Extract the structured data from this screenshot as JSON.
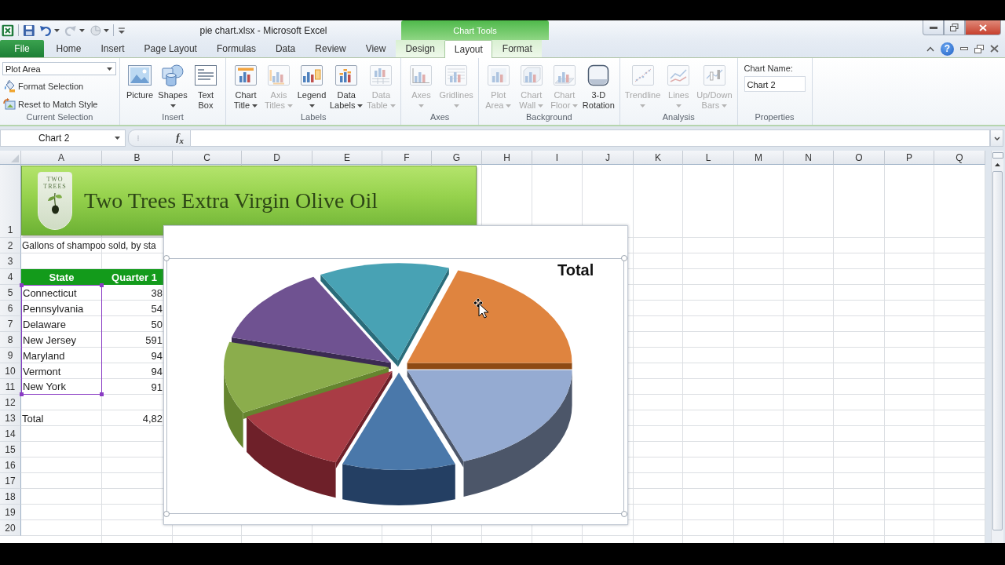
{
  "window": {
    "title": "pie chart.xlsx - Microsoft Excel",
    "contextual_group": "Chart Tools"
  },
  "ribbon_tabs": [
    {
      "label": "File",
      "kind": "file",
      "selected": false
    },
    {
      "label": "Home",
      "kind": "standard",
      "selected": false
    },
    {
      "label": "Insert",
      "kind": "standard",
      "selected": false
    },
    {
      "label": "Page Layout",
      "kind": "standard",
      "selected": false
    },
    {
      "label": "Formulas",
      "kind": "standard",
      "selected": false
    },
    {
      "label": "Data",
      "kind": "standard",
      "selected": false
    },
    {
      "label": "Review",
      "kind": "standard",
      "selected": false
    },
    {
      "label": "View",
      "kind": "standard",
      "selected": false
    },
    {
      "label": "Design",
      "kind": "contextual",
      "selected": false
    },
    {
      "label": "Layout",
      "kind": "contextual",
      "selected": true
    },
    {
      "label": "Format",
      "kind": "contextual",
      "selected": false
    }
  ],
  "help_button": "?",
  "ribbon_groups": [
    {
      "label": "Current Selection",
      "kind": "selection",
      "element_picker": "Plot Area",
      "commands": [
        {
          "label": "Format Selection",
          "disabled": false
        },
        {
          "label": "Reset to Match Style",
          "disabled": false
        }
      ]
    },
    {
      "label": "Insert",
      "kind": "large_buttons",
      "buttons": [
        {
          "label": "Picture",
          "dropdown": false,
          "disabled": false
        },
        {
          "label": "Shapes",
          "dropdown": true,
          "disabled": false
        },
        {
          "label": "Text Box",
          "dropdown": false,
          "disabled": false
        }
      ]
    },
    {
      "label": "Labels",
      "kind": "large_buttons",
      "buttons": [
        {
          "label": "Chart Title",
          "dropdown": true,
          "disabled": false
        },
        {
          "label": "Axis Titles",
          "dropdown": true,
          "disabled": true
        },
        {
          "label": "Legend",
          "dropdown": true,
          "disabled": false
        },
        {
          "label": "Data Labels",
          "dropdown": true,
          "disabled": false
        },
        {
          "label": "Data Table",
          "dropdown": true,
          "disabled": true
        }
      ]
    },
    {
      "label": "Axes",
      "kind": "large_buttons",
      "buttons": [
        {
          "label": "Axes",
          "dropdown": true,
          "disabled": true
        },
        {
          "label": "Gridlines",
          "dropdown": true,
          "disabled": true
        }
      ]
    },
    {
      "label": "Background",
      "kind": "large_buttons",
      "buttons": [
        {
          "label": "Plot Area",
          "dropdown": true,
          "disabled": true
        },
        {
          "label": "Chart Wall",
          "dropdown": true,
          "disabled": true
        },
        {
          "label": "Chart Floor",
          "dropdown": true,
          "disabled": true
        },
        {
          "label": "3-D Rotation",
          "dropdown": false,
          "disabled": false
        }
      ]
    },
    {
      "label": "Analysis",
      "kind": "large_buttons",
      "buttons": [
        {
          "label": "Trendline",
          "dropdown": true,
          "disabled": true
        },
        {
          "label": "Lines",
          "dropdown": true,
          "disabled": true
        },
        {
          "label": "Up/Down Bars",
          "dropdown": true,
          "disabled": true
        }
      ]
    },
    {
      "label": "Properties",
      "kind": "properties",
      "field_label": "Chart Name:",
      "field_value": "Chart 2"
    }
  ],
  "formula_bar": {
    "name_box": "Chart 2",
    "function_button": "f$_{x}$"
  },
  "sheet": {
    "column_headers": [
      "A",
      "B",
      "C",
      "D",
      "E",
      "F",
      "G",
      "H",
      "I",
      "J",
      "K",
      "L",
      "M",
      "N",
      "O",
      "P",
      "Q"
    ],
    "row_headers": [
      "1",
      "2",
      "3",
      "4",
      "5",
      "6",
      "7",
      "8",
      "9",
      "10",
      "11",
      "12",
      "13",
      "14",
      "15",
      "16",
      "17",
      "18",
      "19",
      "20"
    ],
    "banner": {
      "logo_text": "TWO TREES",
      "title": "Two Trees Extra Virgin Olive Oil"
    },
    "subtitle": "Gallons of shampoo sold, by sta",
    "table": {
      "columns": [
        "State",
        "Quarter 1"
      ],
      "rows": [
        {
          "state": "Connecticut",
          "quarter_1": "38"
        },
        {
          "state": "Pennsylvania",
          "quarter_1": "54"
        },
        {
          "state": "Delaware",
          "quarter_1": "50"
        },
        {
          "state": "New Jersey",
          "quarter_1": "591"
        },
        {
          "state": "Maryland",
          "quarter_1": "94"
        },
        {
          "state": "Vermont",
          "quarter_1": "94"
        },
        {
          "state": "New York",
          "quarter_1": "91"
        }
      ],
      "total": {
        "label": "Total",
        "value": "4,82"
      },
      "state_range_highlighted": true
    }
  },
  "chart": {
    "title": "Total",
    "plot_area_selected": true
  }
}
